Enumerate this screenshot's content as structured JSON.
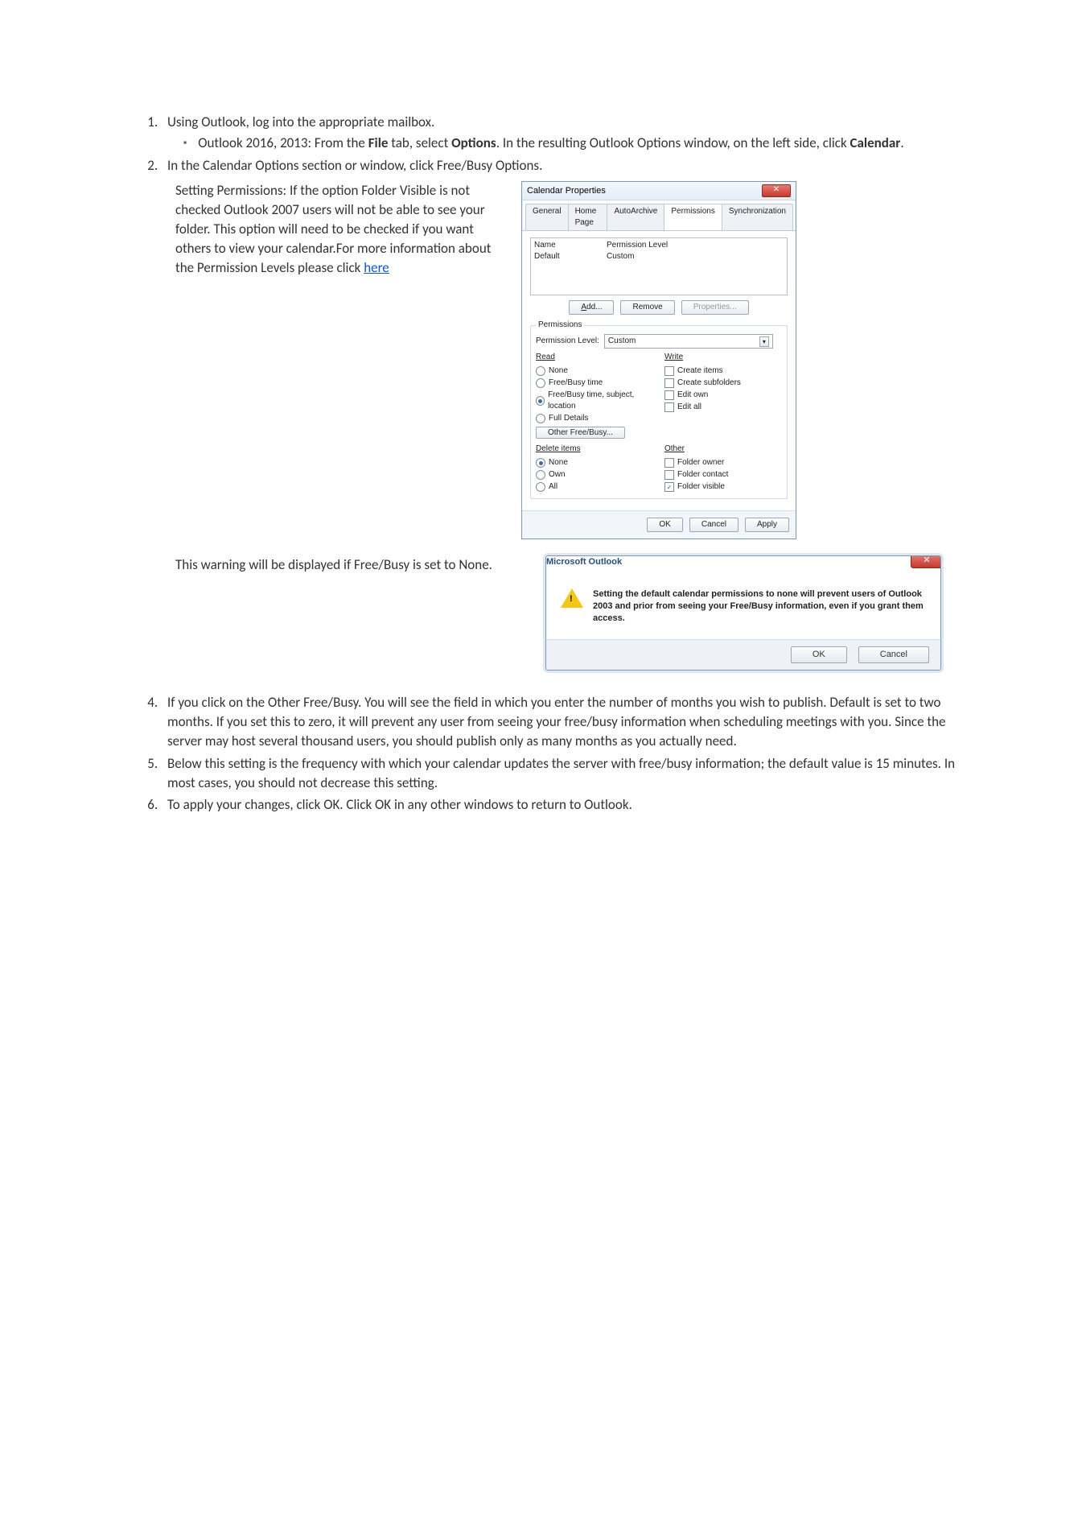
{
  "steps": {
    "s1": "Using Outlook, log into the appropriate mailbox.",
    "s1_sub_pre": "Outlook 2016, 2013: From the ",
    "s1_sub_b1": "File",
    "s1_sub_mid1": " tab, select ",
    "s1_sub_b2": "Options",
    "s1_sub_mid2": ". In the resulting Outlook Options window, on the left side, click ",
    "s1_sub_b3": "Calendar",
    "s1_sub_end": ".",
    "s2": "In the Calendar Options section or window, click Free/Busy Options.",
    "s4": "If you click on the Other Free/Busy. You will see the field in which you enter the number of months you wish to publish. Default is set to two months. If you set this to zero, it will prevent any user from seeing your free/busy information when scheduling meetings with you. Since the server may host several thousand users, you should publish only as many months as you actually need.",
    "s5": "Below this setting is the frequency with which your calendar updates the server with free/busy information; the default value is 15 minutes. In most cases, you should not decrease this setting.",
    "s6": "To apply your changes, click OK. Click OK in any other windows to return to Outlook."
  },
  "para1_pre": "Setting Permissions: If the option Folder Visible is not checked Outlook 2007 users will not be able to see your folder. This option will need to be checked if you want others to view your calendar.For more information about the Permission Levels please click ",
  "para1_link": "here",
  "para2": "This warning will be displayed if Free/Busy is set to None.",
  "dialog": {
    "title": "Calendar Properties",
    "tabs": [
      "General",
      "Home Page",
      "AutoArchive",
      "Permissions",
      "Synchronization"
    ],
    "list_hdr_name": "Name",
    "list_hdr_level": "Permission Level",
    "list_row_name": "Default",
    "list_row_level": "Custom",
    "btn_add": "Add...",
    "btn_remove": "Remove",
    "btn_props": "Properties...",
    "group_label": "Permissions",
    "perm_level_label": "Permission Level:",
    "perm_level_value": "Custom",
    "read_hd": "Read",
    "read_opts": [
      "None",
      "Free/Busy time",
      "Free/Busy time, subject, location",
      "Full Details"
    ],
    "read_selected": 2,
    "other_freebusy_btn": "Other Free/Busy...",
    "write_hd": "Write",
    "write_opts": [
      "Create items",
      "Create subfolders",
      "Edit own",
      "Edit all"
    ],
    "delete_hd": "Delete items",
    "delete_opts": [
      "None",
      "Own",
      "All"
    ],
    "delete_selected": 0,
    "other_hd": "Other",
    "other_opts": [
      "Folder owner",
      "Folder contact",
      "Folder visible"
    ],
    "other_checked": [
      false,
      false,
      true
    ],
    "ok": "OK",
    "cancel": "Cancel",
    "apply": "Apply"
  },
  "warning": {
    "title": "Microsoft Outlook",
    "msg": "Setting the default calendar permissions to none will prevent users of Outlook 2003 and prior from seeing your Free/Busy information, even if you grant them access.",
    "ok": "OK",
    "cancel": "Cancel"
  }
}
